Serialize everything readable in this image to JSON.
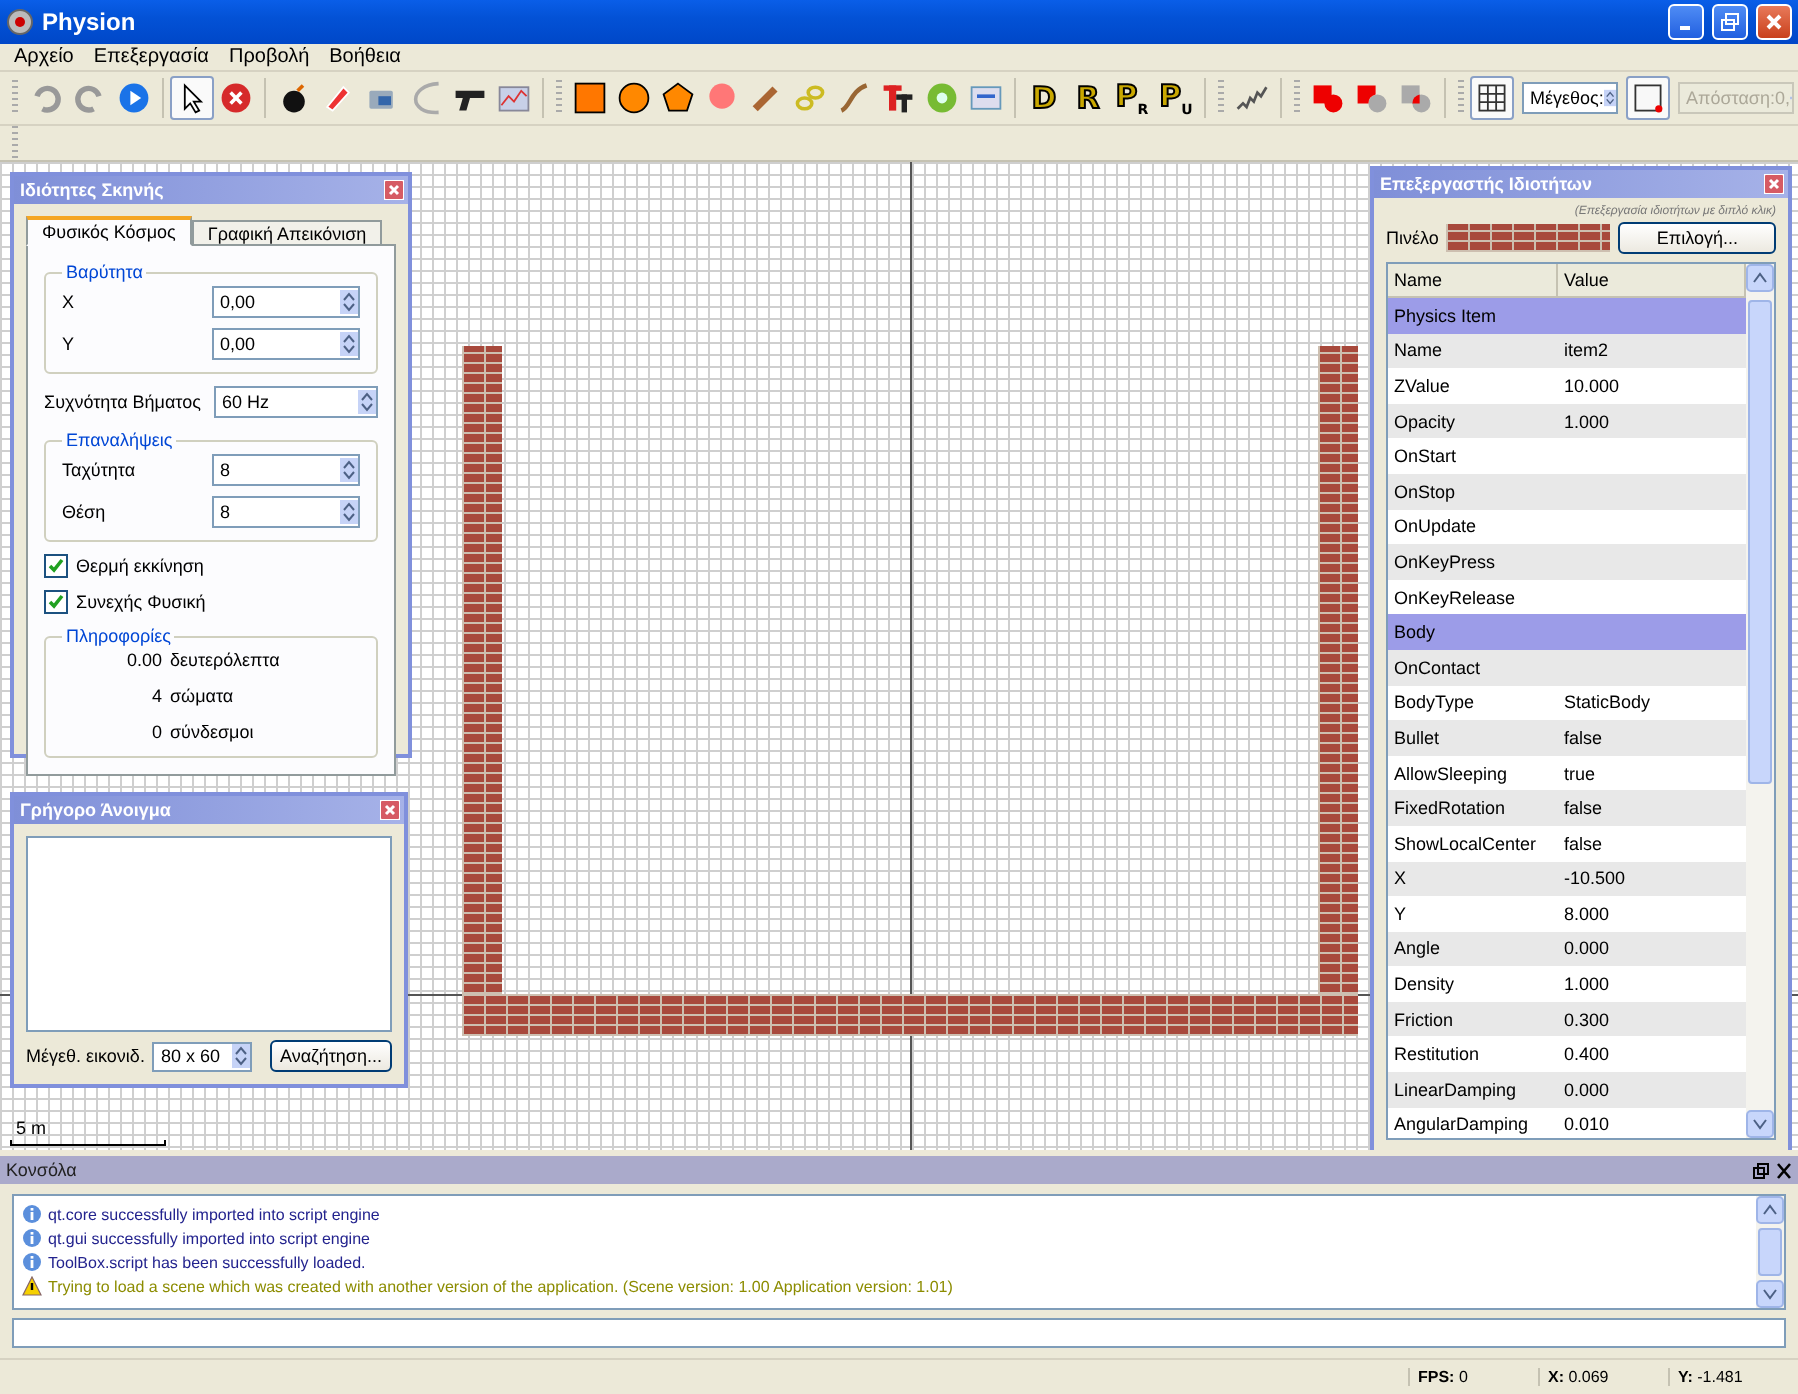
{
  "window": {
    "title": "Physion"
  },
  "menu": [
    "Αρχείο",
    "Επεξεργασία",
    "Προβολή",
    "Βοήθεια"
  ],
  "toolbar": {
    "pointer_pressed": true,
    "grid_pressed": true,
    "snap_pressed": true,
    "joint_tools": [
      "D",
      "R",
      "P$_{R}$",
      "P$_{U}$"
    ],
    "size_field": {
      "value": "Μέγεθος:"
    },
    "distance_field": {
      "value": "Απόσταση:0,",
      "disabled": true
    }
  },
  "scene_properties": {
    "title": "Ιδιότητες Σκηνής",
    "tabs": [
      {
        "label": "Φυσικός Κόσμος",
        "selected": true
      },
      {
        "label": "Γραφική Απεικόνιση",
        "selected": false
      }
    ],
    "gravity": {
      "legend": "Βαρύτητα",
      "fields": [
        {
          "label": "X",
          "value": "0,00"
        },
        {
          "label": "Y",
          "value": "0,00"
        }
      ]
    },
    "step_frequency": {
      "label": "Συχνότητα Βήματος",
      "value": "60 Hz"
    },
    "iterations": {
      "legend": "Επαναλήψεις",
      "fields": [
        {
          "label": "Ταχύτητα",
          "value": "8"
        },
        {
          "label": "Θέση",
          "value": "8"
        }
      ]
    },
    "checkboxes": [
      {
        "label": "Θερμή εκκίνηση",
        "checked": true
      },
      {
        "label": "Συνεχής Φυσική",
        "checked": true
      }
    ],
    "info": {
      "legend": "Πληροφορίες",
      "rows": [
        {
          "value": "0.00",
          "label": "δευτερόλεπτα"
        },
        {
          "value": "4",
          "label": "σώματα"
        },
        {
          "value": "0",
          "label": "σύνδεσμοι"
        }
      ]
    }
  },
  "quick_open": {
    "title": "Γρήγορο Άνοιγμα",
    "icon_size_label": "Μέγεθ. εικονιδ.",
    "icon_size": "80 x 60",
    "search_button": "Αναζήτηση..."
  },
  "scale": {
    "label": "5 m"
  },
  "property_editor": {
    "title": "Επεξεργαστής Ιδιοτήτων",
    "hint": "(Επεξεργασία ιδιοτήτων με διπλό κλικ)",
    "brush_label": "Πινέλο",
    "choose_button": "Επιλογή...",
    "columns": [
      "Name",
      "Value"
    ],
    "rows": [
      {
        "kind": "group",
        "name": "Physics Item"
      },
      {
        "kind": "property",
        "name": "Name",
        "value": "item2"
      },
      {
        "kind": "property",
        "name": "ZValue",
        "value": "10.000"
      },
      {
        "kind": "property",
        "name": "Opacity",
        "value": "1.000"
      },
      {
        "kind": "property",
        "name": "OnStart"
      },
      {
        "kind": "property",
        "name": "OnStop"
      },
      {
        "kind": "property",
        "name": "OnUpdate"
      },
      {
        "kind": "property",
        "name": "OnKeyPress"
      },
      {
        "kind": "property",
        "name": "OnKeyRelease"
      },
      {
        "kind": "group",
        "name": "Body"
      },
      {
        "kind": "property",
        "name": "OnContact"
      },
      {
        "kind": "property",
        "name": "BodyType",
        "value": "StaticBody"
      },
      {
        "kind": "property",
        "name": "Bullet",
        "value": "false"
      },
      {
        "kind": "property",
        "name": "AllowSleeping",
        "value": "true"
      },
      {
        "kind": "property",
        "name": "FixedRotation",
        "value": "false"
      },
      {
        "kind": "property",
        "name": "ShowLocalCenter",
        "value": "false"
      },
      {
        "kind": "property",
        "name": "X",
        "value": "-10.500"
      },
      {
        "kind": "property",
        "name": "Y",
        "value": "8.000"
      },
      {
        "kind": "property",
        "name": "Angle",
        "value": "0.000"
      },
      {
        "kind": "property",
        "name": "Density",
        "value": "1.000"
      },
      {
        "kind": "property",
        "name": "Friction",
        "value": "0.300"
      },
      {
        "kind": "property",
        "name": "Restitution",
        "value": "0.400"
      },
      {
        "kind": "property",
        "name": "LinearDamping",
        "value": "0.000"
      },
      {
        "kind": "property",
        "name": "AngularDamping",
        "value": "0.010"
      }
    ]
  },
  "console": {
    "title": "Κονσόλα",
    "messages": [
      {
        "kind": "info",
        "text": "qt.core successfully imported into script engine"
      },
      {
        "kind": "info",
        "text": "qt.gui successfully imported into script engine"
      },
      {
        "kind": "info",
        "text": "ToolBox.script has been successfully loaded."
      },
      {
        "kind": "warning",
        "text": "Trying to load a scene which was created with another version of the application. (Scene version: 1.00 Application version: 1.01)"
      }
    ]
  },
  "status_bar": {
    "fps": "**FPS:** 0",
    "x": "**X:** 0.069",
    "y": "**Y:** -1.481"
  }
}
